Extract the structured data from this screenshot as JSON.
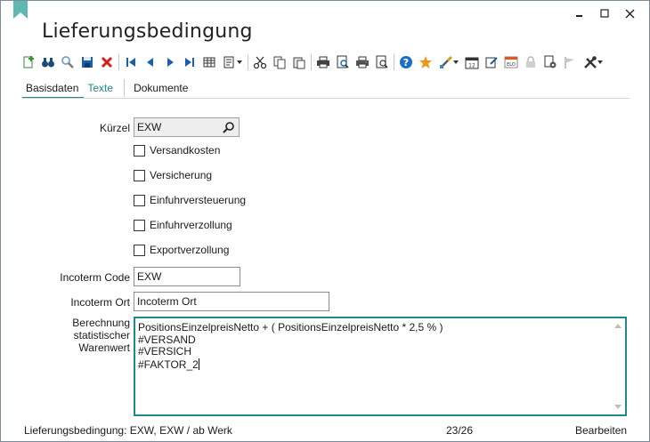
{
  "window": {
    "title": "Lieferungsbedingung",
    "controls": {
      "minimize": "minimize-icon",
      "maximize": "maximize-icon",
      "close": "close-icon"
    }
  },
  "colors": {
    "accent": "#1e8a8a",
    "bookmark": "#5fb8b0"
  },
  "toolbar": {
    "icons": [
      "new-icon",
      "binoculars-icon",
      "search-icon",
      "save-icon",
      "delete-icon",
      "first-record-icon",
      "previous-record-icon",
      "next-record-icon",
      "last-record-icon",
      "table-view-icon",
      "form-view-icon",
      "cut-icon",
      "copy-icon",
      "paste-icon",
      "print-icon",
      "print-preview-icon",
      "print-setup-icon",
      "report-icon",
      "help-icon",
      "favorite-icon",
      "tools-brush-icon",
      "calendar-icon",
      "edit-note-icon",
      "elo-icon",
      "lock-icon",
      "document-settings-icon",
      "flag-icon",
      "wrench-tools-icon"
    ]
  },
  "tabs": [
    {
      "label": "Basisdaten",
      "active": true
    },
    {
      "label": "Texte",
      "active": false
    },
    {
      "label": "Dokumente",
      "active": false
    }
  ],
  "form": {
    "kuerzel_label": "Kürzel",
    "kuerzel_value": "EXW",
    "checkboxes": [
      {
        "label": "Versandkosten",
        "checked": false
      },
      {
        "label": "Versicherung",
        "checked": false
      },
      {
        "label": "Einfuhrversteuerung",
        "checked": false
      },
      {
        "label": "Einfuhrverzollung",
        "checked": false
      },
      {
        "label": "Exportverzollung",
        "checked": false
      }
    ],
    "incoterm_code_label": "Incoterm Code",
    "incoterm_code_value": "EXW",
    "incoterm_ort_label": "Incoterm Ort",
    "incoterm_ort_value": "Incoterm Ort",
    "berechnung_label_1": "Berechnung",
    "berechnung_label_2": "statistischer",
    "berechnung_label_3": "Warenwert",
    "berechnung_lines": [
      "PositionsEinzelpreisNetto + ( PositionsEinzelpreisNetto * 2,5 % )",
      "#VERSAND",
      "#VERSICH",
      "#FAKTOR_2"
    ]
  },
  "status": {
    "record": "Lieferungsbedingung: EXW, EXW / ab Werk",
    "position": "23/26",
    "mode": "Bearbeiten"
  }
}
